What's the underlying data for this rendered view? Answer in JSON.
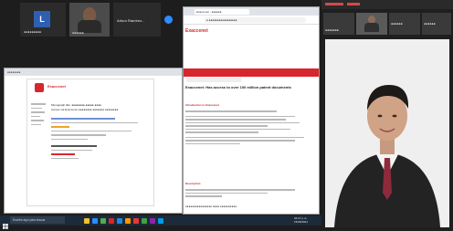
{
  "meeting": {
    "participants": [
      {
        "initial": "L",
        "name": "●●●●●●●●●"
      },
      {
        "name": "●●●●●●"
      },
      {
        "name": "Arturo Ramírez..."
      }
    ],
    "right_strip": [
      {
        "name": "●●●●●●●"
      },
      {
        "name": "●●●●●"
      },
      {
        "name": "●●●●●●"
      },
      {
        "name": "●●●●●●"
      }
    ]
  },
  "shared_screen": {
    "left_window": {
      "title": "●●●●●●●●",
      "brand": "Exaccenet",
      "heading": "Monograph title: ●●●●●●●● ●●●●● ●●●●",
      "subheading": "Access via Exaccenet ●●●●●●●● ●●●●●●● ●●●●●●●●"
    },
    "browser": {
      "tab_title": "Exaccenet - ●●●●●●",
      "address": "● ●●●●●●●●●●●●●●●●●",
      "brand": "Exaccenet",
      "headline": "Exaccenet: Has access to over 100 million patent documents",
      "section_1": "Introduction to Exaccenet",
      "section_2": "Description",
      "footer_text": "●●●●●●●●●●●●●●●● ●●●● ●●●●●●●●●●"
    },
    "taskbar": {
      "search_placeholder": "Escribe aquí para buscar",
      "time": "04:27 p.m.",
      "date": "15/06/2021"
    }
  },
  "colors": {
    "brand_red": "#d7262d",
    "zoom_blue": "#2d8cff",
    "avatar_blue": "#2f5fb2",
    "taskbar": "#1c2a3a"
  },
  "icons": [
    "microphone-icon",
    "camera-icon",
    "search-icon",
    "windows-start-icon",
    "folder-icon",
    "browser-icon"
  ]
}
